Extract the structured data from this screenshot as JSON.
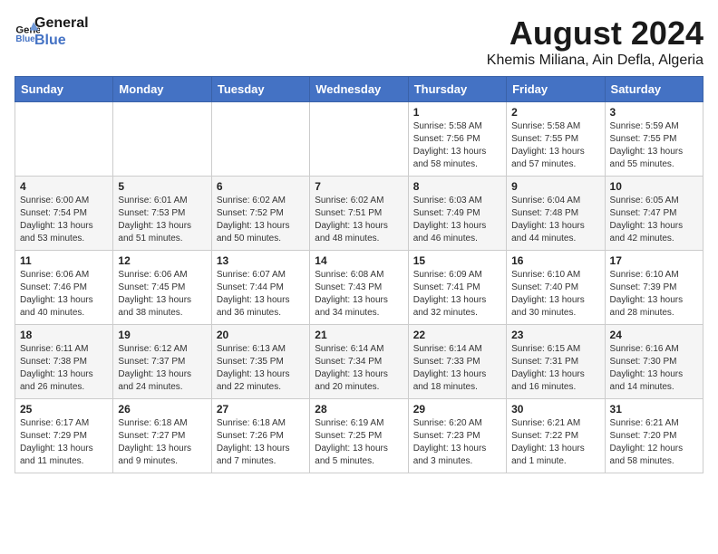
{
  "header": {
    "logo_line1": "General",
    "logo_line2": "Blue",
    "month_year": "August 2024",
    "location": "Khemis Miliana, Ain Defla, Algeria"
  },
  "weekdays": [
    "Sunday",
    "Monday",
    "Tuesday",
    "Wednesday",
    "Thursday",
    "Friday",
    "Saturday"
  ],
  "weeks": [
    [
      {
        "day": "",
        "info": ""
      },
      {
        "day": "",
        "info": ""
      },
      {
        "day": "",
        "info": ""
      },
      {
        "day": "",
        "info": ""
      },
      {
        "day": "1",
        "info": "Sunrise: 5:58 AM\nSunset: 7:56 PM\nDaylight: 13 hours\nand 58 minutes."
      },
      {
        "day": "2",
        "info": "Sunrise: 5:58 AM\nSunset: 7:55 PM\nDaylight: 13 hours\nand 57 minutes."
      },
      {
        "day": "3",
        "info": "Sunrise: 5:59 AM\nSunset: 7:55 PM\nDaylight: 13 hours\nand 55 minutes."
      }
    ],
    [
      {
        "day": "4",
        "info": "Sunrise: 6:00 AM\nSunset: 7:54 PM\nDaylight: 13 hours\nand 53 minutes."
      },
      {
        "day": "5",
        "info": "Sunrise: 6:01 AM\nSunset: 7:53 PM\nDaylight: 13 hours\nand 51 minutes."
      },
      {
        "day": "6",
        "info": "Sunrise: 6:02 AM\nSunset: 7:52 PM\nDaylight: 13 hours\nand 50 minutes."
      },
      {
        "day": "7",
        "info": "Sunrise: 6:02 AM\nSunset: 7:51 PM\nDaylight: 13 hours\nand 48 minutes."
      },
      {
        "day": "8",
        "info": "Sunrise: 6:03 AM\nSunset: 7:49 PM\nDaylight: 13 hours\nand 46 minutes."
      },
      {
        "day": "9",
        "info": "Sunrise: 6:04 AM\nSunset: 7:48 PM\nDaylight: 13 hours\nand 44 minutes."
      },
      {
        "day": "10",
        "info": "Sunrise: 6:05 AM\nSunset: 7:47 PM\nDaylight: 13 hours\nand 42 minutes."
      }
    ],
    [
      {
        "day": "11",
        "info": "Sunrise: 6:06 AM\nSunset: 7:46 PM\nDaylight: 13 hours\nand 40 minutes."
      },
      {
        "day": "12",
        "info": "Sunrise: 6:06 AM\nSunset: 7:45 PM\nDaylight: 13 hours\nand 38 minutes."
      },
      {
        "day": "13",
        "info": "Sunrise: 6:07 AM\nSunset: 7:44 PM\nDaylight: 13 hours\nand 36 minutes."
      },
      {
        "day": "14",
        "info": "Sunrise: 6:08 AM\nSunset: 7:43 PM\nDaylight: 13 hours\nand 34 minutes."
      },
      {
        "day": "15",
        "info": "Sunrise: 6:09 AM\nSunset: 7:41 PM\nDaylight: 13 hours\nand 32 minutes."
      },
      {
        "day": "16",
        "info": "Sunrise: 6:10 AM\nSunset: 7:40 PM\nDaylight: 13 hours\nand 30 minutes."
      },
      {
        "day": "17",
        "info": "Sunrise: 6:10 AM\nSunset: 7:39 PM\nDaylight: 13 hours\nand 28 minutes."
      }
    ],
    [
      {
        "day": "18",
        "info": "Sunrise: 6:11 AM\nSunset: 7:38 PM\nDaylight: 13 hours\nand 26 minutes."
      },
      {
        "day": "19",
        "info": "Sunrise: 6:12 AM\nSunset: 7:37 PM\nDaylight: 13 hours\nand 24 minutes."
      },
      {
        "day": "20",
        "info": "Sunrise: 6:13 AM\nSunset: 7:35 PM\nDaylight: 13 hours\nand 22 minutes."
      },
      {
        "day": "21",
        "info": "Sunrise: 6:14 AM\nSunset: 7:34 PM\nDaylight: 13 hours\nand 20 minutes."
      },
      {
        "day": "22",
        "info": "Sunrise: 6:14 AM\nSunset: 7:33 PM\nDaylight: 13 hours\nand 18 minutes."
      },
      {
        "day": "23",
        "info": "Sunrise: 6:15 AM\nSunset: 7:31 PM\nDaylight: 13 hours\nand 16 minutes."
      },
      {
        "day": "24",
        "info": "Sunrise: 6:16 AM\nSunset: 7:30 PM\nDaylight: 13 hours\nand 14 minutes."
      }
    ],
    [
      {
        "day": "25",
        "info": "Sunrise: 6:17 AM\nSunset: 7:29 PM\nDaylight: 13 hours\nand 11 minutes."
      },
      {
        "day": "26",
        "info": "Sunrise: 6:18 AM\nSunset: 7:27 PM\nDaylight: 13 hours\nand 9 minutes."
      },
      {
        "day": "27",
        "info": "Sunrise: 6:18 AM\nSunset: 7:26 PM\nDaylight: 13 hours\nand 7 minutes."
      },
      {
        "day": "28",
        "info": "Sunrise: 6:19 AM\nSunset: 7:25 PM\nDaylight: 13 hours\nand 5 minutes."
      },
      {
        "day": "29",
        "info": "Sunrise: 6:20 AM\nSunset: 7:23 PM\nDaylight: 13 hours\nand 3 minutes."
      },
      {
        "day": "30",
        "info": "Sunrise: 6:21 AM\nSunset: 7:22 PM\nDaylight: 13 hours\nand 1 minute."
      },
      {
        "day": "31",
        "info": "Sunrise: 6:21 AM\nSunset: 7:20 PM\nDaylight: 12 hours\nand 58 minutes."
      }
    ]
  ]
}
